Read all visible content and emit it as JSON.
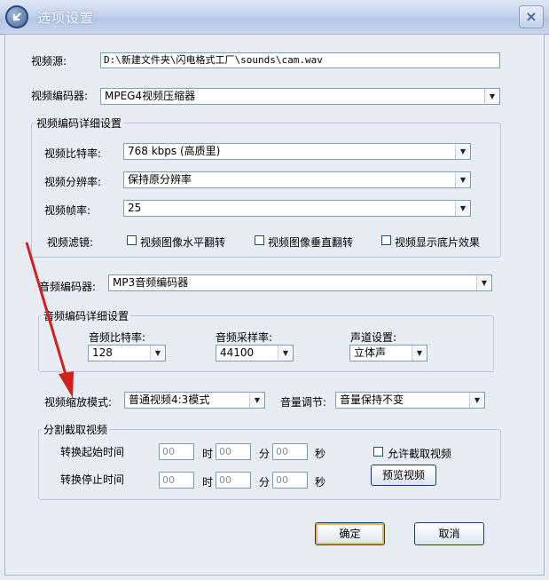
{
  "window": {
    "title": "选项设置"
  },
  "video": {
    "source_label": "视频源:",
    "source_value": "D:\\新建文件夹\\闪电格式工厂\\sounds\\cam.wav",
    "encoder_label": "视频编码器:",
    "encoder_value": "MPEG4视频压缩器",
    "detail_title": "视频编码详细设置",
    "bitrate_label": "视频比特率:",
    "bitrate_value": "768 kbps (高质里)",
    "resolution_label": "视频分辨率:",
    "resolution_value": "保持原分辨率",
    "framerate_label": "视频帧率:",
    "framerate_value": "25",
    "filter_label": "视频滤镜:",
    "filters": [
      "视频图像水平翻转",
      "视频图像垂直翻转",
      "视频显示底片效果"
    ]
  },
  "audio": {
    "encoder_label": "音频编码器:",
    "encoder_value": "MP3音频编码器",
    "detail_title": "音频编码详细设置",
    "bitrate_label": "音频比特率:",
    "bitrate_value": "128",
    "samplerate_label": "音频采样率:",
    "samplerate_value": "44100",
    "channel_label": "声道设置:",
    "channel_value": "立体声"
  },
  "scale": {
    "mode_label": "视频缩放模式:",
    "mode_value": "普通视频4:3模式",
    "volume_label": "音量调节:",
    "volume_value": "音量保持不变"
  },
  "split": {
    "title": "分割截取视频",
    "start_label": "转换起始时间",
    "stop_label": "转换停止时间",
    "hour_unit": "时",
    "min_unit": "分",
    "sec_unit": "秒",
    "placeholder": "00",
    "allow_label": "允许截取视频",
    "preview_label": "预览视频"
  },
  "buttons": {
    "ok": "确定",
    "cancel": "取消"
  },
  "colors": {
    "arrow": "#d3201f",
    "titlebar": "#b4c4e3",
    "border": "#7f9db9"
  }
}
